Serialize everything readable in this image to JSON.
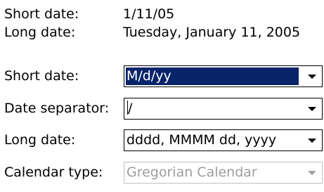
{
  "preview": {
    "short_date_label": "Short date:",
    "short_date_value": "1/11/05",
    "long_date_label": "Long date:",
    "long_date_value": "Tuesday, January 11, 2005"
  },
  "fields": {
    "short_date": {
      "label": "Short date:",
      "value": "M/d/yy",
      "selected": true
    },
    "date_separator": {
      "label": "Date separator:",
      "value": "/"
    },
    "long_date": {
      "label": "Long date:",
      "value": "dddd, MMMM dd, yyyy"
    },
    "calendar_type": {
      "label": "Calendar type:",
      "value": "Gregorian Calendar",
      "disabled": true
    }
  },
  "colors": {
    "selection": "#0a246a",
    "disabled_text": "#9d9d9d",
    "dropdown-arrow-icon": "#000000"
  }
}
